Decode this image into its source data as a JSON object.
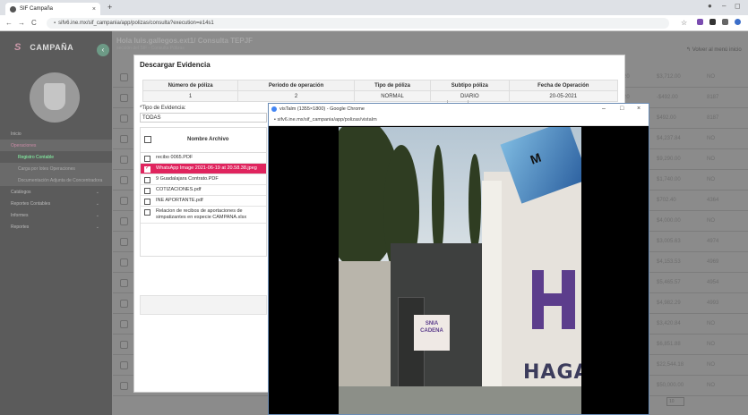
{
  "browser": {
    "tab_title": "SIF Campaña",
    "url": "sifv6.ine.mx/sif_campania/app/polizas/consulta?execution=e14s1",
    "new_tab": "+",
    "tab_close": "×",
    "min": "–",
    "max": "◻",
    "back": "←",
    "forward": "→",
    "reload": "C",
    "lock": "🔒",
    "star": "☆"
  },
  "app": {
    "brand_logo": "S",
    "brand_name": "CAMPAÑA",
    "collapse": "‹",
    "page_title": "Hola luis.gallegos.ext1/ Consulta TEPJF",
    "page_subtitle": "sección del SIF - Consulta Pólizas",
    "back_link": "↰ Volver al menú inicio",
    "menu": [
      {
        "label": "Inicio",
        "kind": "normal"
      },
      {
        "label": "Operaciones",
        "kind": "active"
      },
      {
        "label": "Registro Contable",
        "kind": "sub"
      },
      {
        "label": "Carga por lotes Operaciones",
        "kind": "sub2"
      },
      {
        "label": "Documentación Adjunta de Concentradora",
        "kind": "sub2"
      },
      {
        "label": "Catálogos",
        "kind": "normal"
      },
      {
        "label": "Reportes Contables",
        "kind": "normal"
      },
      {
        "label": "Informes",
        "kind": "normal"
      },
      {
        "label": "Reportes",
        "kind": "normal"
      }
    ],
    "bg_rows": [
      {
        "d": "20",
        "amt": "$3,712.00",
        "code": "NO"
      },
      {
        "d": "20",
        "amt": "-$492.00",
        "code": "8187"
      },
      {
        "d": "",
        "amt": "$492.00",
        "code": "8187"
      },
      {
        "d": "",
        "amt": "$4,237.84",
        "code": "NO"
      },
      {
        "d": "",
        "amt": "$9,290.00",
        "code": "NO"
      },
      {
        "d": "",
        "amt": "$1,740.00",
        "code": "NO"
      },
      {
        "d": "",
        "amt": "$702.40",
        "code": "4364"
      },
      {
        "d": "",
        "amt": "$4,000.00",
        "code": "NO"
      },
      {
        "d": "",
        "amt": "$3,005.63",
        "code": "4974"
      },
      {
        "d": "",
        "amt": "$4,153.53",
        "code": "4969"
      },
      {
        "d": "",
        "amt": "$5,465.57",
        "code": "4954"
      },
      {
        "d": "",
        "amt": "$4,982.29",
        "code": "4993"
      },
      {
        "d": "",
        "amt": "$3,420.84",
        "code": "NO"
      },
      {
        "d": "",
        "amt": "$6,851.88",
        "code": "NO"
      },
      {
        "d": "",
        "amt": "$22,544.18",
        "code": "NO"
      },
      {
        "d": "",
        "amt": "$50,000.00",
        "code": "NO"
      }
    ],
    "page_size": "10"
  },
  "modal": {
    "title": "Descargar Evidencia",
    "headers": [
      "Número de póliza",
      "Periodo de operación",
      "Tipo de póliza",
      "Subtipo póliza",
      "Fecha de Operación"
    ],
    "row": [
      "1",
      "2",
      "NORMAL",
      "DIARIO",
      "20-05-2021"
    ],
    "evidence_label": "*Tipo de Evidencia:",
    "evidence_value": "TODAS",
    "files_header": "Nombre Archivo",
    "files": [
      {
        "name": "recibo 0065.PDF",
        "selected": false
      },
      {
        "name": "WhatsApp Image 2021-06-19 at 20.58.38.jpeg",
        "selected": true
      },
      {
        "name": "9 Guadalajara Contrato.PDF",
        "selected": false
      },
      {
        "name": "COTIZACIONES.pdf",
        "selected": false
      },
      {
        "name": "INE APORTANTE.pdf",
        "selected": false
      },
      {
        "name": "Relacion de recibos de aportaciones de simpatizantes en especie CAMPANA.xlsx",
        "selected": false
      }
    ]
  },
  "popup": {
    "title": "visTalm (1355×1800) - Google Chrome",
    "url": "sifv6.ine.mx/sif_campania/app/polizas/vistaIm",
    "min": "–",
    "max": "□",
    "close": "×",
    "photo_text": "HAGAN",
    "flag_text": "M",
    "banner_text": "SNIA CADENA"
  },
  "colors": {
    "selected_row": "#e0245e",
    "accent_purple": "#5c3d8c"
  }
}
